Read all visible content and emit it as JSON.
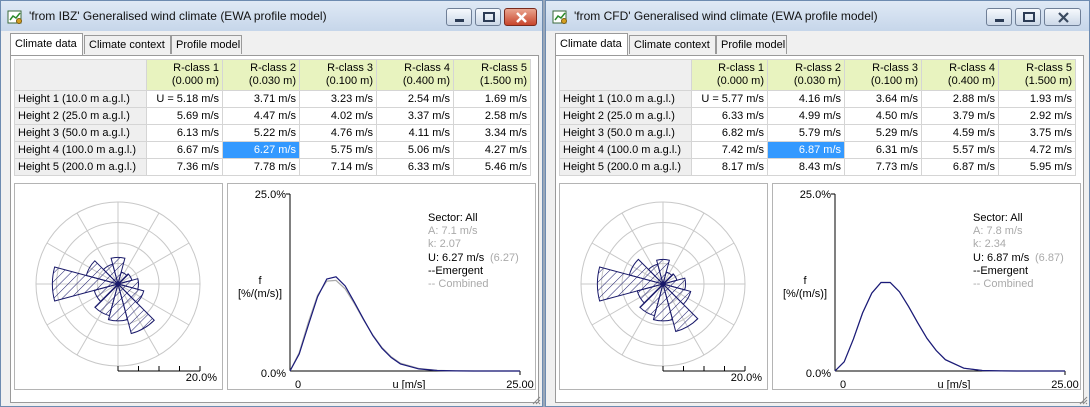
{
  "windows": [
    {
      "title": "'from IBZ' Generalised wind climate (EWA profile model)",
      "tabs": [
        {
          "label": "Climate data",
          "active": true
        },
        {
          "label": "Climate context",
          "active": false
        },
        {
          "label": "Profile model",
          "active": false
        }
      ],
      "table": {
        "columns": [
          {
            "name": "R-class 1",
            "sub": "(0.000 m)"
          },
          {
            "name": "R-class 2",
            "sub": "(0.030 m)"
          },
          {
            "name": "R-class 3",
            "sub": "(0.100 m)"
          },
          {
            "name": "R-class 4",
            "sub": "(0.400 m)"
          },
          {
            "name": "R-class 5",
            "sub": "(1.500 m)"
          }
        ],
        "rows": [
          {
            "label": "Height 1  (10.0 m a.g.l.)",
            "values": [
              "U = 5.18 m/s",
              "3.71 m/s",
              "3.23 m/s",
              "2.54 m/s",
              "1.69 m/s"
            ]
          },
          {
            "label": "Height 2  (25.0 m a.g.l.)",
            "values": [
              "5.69 m/s",
              "4.47 m/s",
              "4.02 m/s",
              "3.37 m/s",
              "2.58 m/s"
            ]
          },
          {
            "label": "Height 3  (50.0 m a.g.l.)",
            "values": [
              "6.13 m/s",
              "5.22 m/s",
              "4.76 m/s",
              "4.11 m/s",
              "3.34 m/s"
            ]
          },
          {
            "label": "Height 4  (100.0 m a.g.l.)",
            "values": [
              "6.67 m/s",
              "6.27 m/s",
              "5.75 m/s",
              "5.06 m/s",
              "4.27 m/s"
            ]
          },
          {
            "label": "Height 5  (200.0 m a.g.l.)",
            "values": [
              "7.36 m/s",
              "7.78 m/s",
              "7.14 m/s",
              "6.33 m/s",
              "5.46 m/s"
            ]
          }
        ],
        "selected_cell": {
          "row": 3,
          "col": 1
        }
      },
      "rose": {
        "scale_label": "20.0%",
        "sectors_percent": [
          6.5,
          3,
          3.5,
          5,
          6.5,
          12.5,
          9,
          8,
          6,
          16,
          8,
          5
        ]
      },
      "chart_data": {
        "type": "line",
        "xlabel": "u [m/s]",
        "ylabel": "f\n[%/(m/s)]",
        "xlim": [
          0,
          25
        ],
        "ylim": [
          0,
          25
        ],
        "x_tick_labels": [
          "0",
          "25.00"
        ],
        "y_tick_labels": [
          "0.0%",
          "25.0%"
        ],
        "series": [
          {
            "name": "Emergent",
            "color": "#1a1a7a",
            "weibull_A": 7.1,
            "weibull_k": 2.07,
            "x": [
              0,
              1,
              2,
              3,
              4,
              5,
              6,
              7,
              8,
              9,
              10,
              11,
              12,
              14,
              16,
              18,
              20,
              22,
              25
            ],
            "y": [
              0,
              2.4,
              6.5,
              10.5,
              13.0,
              13.3,
              12.0,
              9.7,
              7.3,
              5.0,
              3.2,
              1.9,
              1.0,
              0.3,
              0.07,
              0.01,
              0,
              0,
              0
            ]
          },
          {
            "name": "Combined",
            "color": "#aaaaaa",
            "x": [
              0,
              1,
              2,
              3,
              4,
              5,
              6,
              7,
              8,
              9,
              10,
              11,
              12,
              14,
              16,
              18,
              20,
              22,
              25
            ],
            "y": [
              0,
              2.6,
              6.9,
              10.7,
              12.7,
              12.8,
              11.6,
              9.5,
              7.2,
              5.1,
              3.3,
              2.0,
              1.1,
              0.35,
              0.08,
              0.01,
              0,
              0,
              0
            ]
          }
        ]
      },
      "legend": {
        "sector": "Sector: All",
        "a": "A: 7.1 m/s",
        "k": "k: 2.07",
        "u": "U: 6.27 m/s",
        "u_combined": "(6.27)",
        "emergent": "--Emergent",
        "combined": "-- Combined"
      }
    },
    {
      "title": "'from CFD' Generalised wind climate (EWA profile model)",
      "tabs": [
        {
          "label": "Climate data",
          "active": true
        },
        {
          "label": "Climate context",
          "active": false
        },
        {
          "label": "Profile model",
          "active": false
        }
      ],
      "table": {
        "columns": [
          {
            "name": "R-class 1",
            "sub": "(0.000 m)"
          },
          {
            "name": "R-class 2",
            "sub": "(0.030 m)"
          },
          {
            "name": "R-class 3",
            "sub": "(0.100 m)"
          },
          {
            "name": "R-class 4",
            "sub": "(0.400 m)"
          },
          {
            "name": "R-class 5",
            "sub": "(1.500 m)"
          }
        ],
        "rows": [
          {
            "label": "Height 1  (10.0 m a.g.l.)",
            "values": [
              "U = 5.77 m/s",
              "4.16 m/s",
              "3.64 m/s",
              "2.88 m/s",
              "1.93 m/s"
            ]
          },
          {
            "label": "Height 2  (25.0 m a.g.l.)",
            "values": [
              "6.33 m/s",
              "4.99 m/s",
              "4.50 m/s",
              "3.79 m/s",
              "2.92 m/s"
            ]
          },
          {
            "label": "Height 3  (50.0 m a.g.l.)",
            "values": [
              "6.82 m/s",
              "5.79 m/s",
              "5.29 m/s",
              "4.59 m/s",
              "3.75 m/s"
            ]
          },
          {
            "label": "Height 4  (100.0 m a.g.l.)",
            "values": [
              "7.42 m/s",
              "6.87 m/s",
              "6.31 m/s",
              "5.57 m/s",
              "4.72 m/s"
            ]
          },
          {
            "label": "Height 5  (200.0 m a.g.l.)",
            "values": [
              "8.17 m/s",
              "8.43 m/s",
              "7.73 m/s",
              "6.87 m/s",
              "5.95 m/s"
            ]
          }
        ],
        "selected_cell": {
          "row": 3,
          "col": 1
        }
      },
      "rose": {
        "scale_label": "20.0%",
        "sectors_percent": [
          6,
          3,
          3.5,
          5.5,
          7,
          12,
          9,
          8,
          6.5,
          16,
          8.5,
          5
        ]
      },
      "chart_data": {
        "type": "line",
        "xlabel": "u [m/s]",
        "ylabel": "f\n[%/(m/s)]",
        "xlim": [
          0,
          25
        ],
        "ylim": [
          0,
          25
        ],
        "x_tick_labels": [
          "0",
          "25.00"
        ],
        "y_tick_labels": [
          "0.0%",
          "25.0%"
        ],
        "series": [
          {
            "name": "Emergent",
            "color": "#1a1a7a",
            "weibull_A": 7.8,
            "weibull_k": 2.34,
            "x": [
              0,
              1,
              2,
              3,
              4,
              5,
              6,
              7,
              8,
              9,
              10,
              11,
              12,
              14,
              16,
              18,
              20,
              22,
              25
            ],
            "y": [
              0,
              1.3,
              4.5,
              8.2,
              11.0,
              12.5,
              12.5,
              11.2,
              9.1,
              6.8,
              4.6,
              2.9,
              1.6,
              0.4,
              0.07,
              0.01,
              0,
              0,
              0
            ]
          },
          {
            "name": "Combined",
            "color": "#aaaaaa",
            "x": [
              0,
              1,
              2,
              3,
              4,
              5,
              6,
              7,
              8,
              9,
              10,
              11,
              12,
              14,
              16,
              18,
              20,
              22,
              25
            ],
            "y": [
              0,
              1.3,
              4.5,
              8.2,
              11.0,
              12.5,
              12.5,
              11.2,
              9.1,
              6.8,
              4.6,
              2.9,
              1.6,
              0.4,
              0.07,
              0.01,
              0,
              0,
              0
            ]
          }
        ]
      },
      "legend": {
        "sector": "Sector: All",
        "a": "A: 7.8 m/s",
        "k": "k: 2.34",
        "u": "U: 6.87 m/s",
        "u_combined": "(6.87)",
        "emergent": "--Emergent",
        "combined": "-- Combined"
      }
    }
  ],
  "colors": {
    "header_bg": "#e8f3bf",
    "selection": "#3399ff",
    "emergent": "#1a1a7a",
    "combined": "#aaaaaa",
    "close_button": "#c8452c"
  },
  "icons": [
    "app-icon",
    "minimize-icon",
    "maximize-icon",
    "close-icon",
    "resize-grip-icon"
  ]
}
